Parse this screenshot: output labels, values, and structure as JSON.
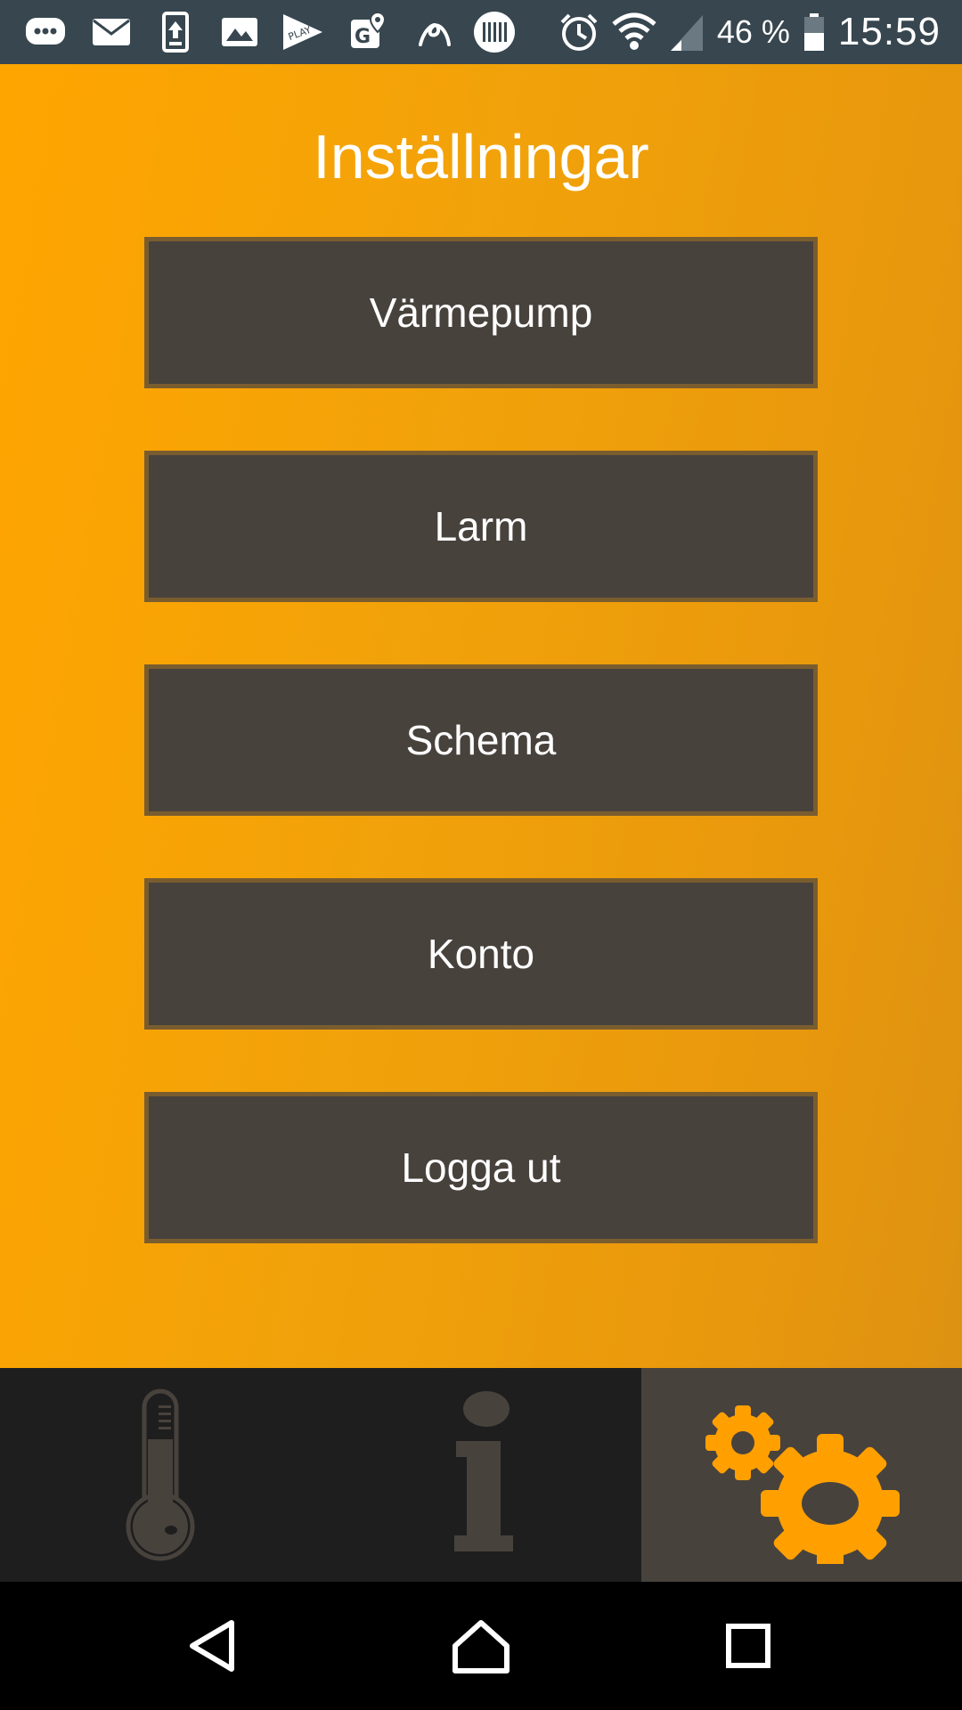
{
  "status_bar": {
    "battery_percent": "46 %",
    "time": "15:59",
    "notification_icons": [
      "chat-icon",
      "mail-icon",
      "upload-icon",
      "image-icon",
      "play-store-icon",
      "maps-icon",
      "app-icon",
      "barcode-icon"
    ],
    "system_icons": [
      "alarm-icon",
      "wifi-icon",
      "signal-icon",
      "battery-icon"
    ]
  },
  "screen": {
    "title": "Inställningar"
  },
  "menu": {
    "items": [
      {
        "label": "Värmepump"
      },
      {
        "label": "Larm"
      },
      {
        "label": "Schema"
      },
      {
        "label": "Konto"
      },
      {
        "label": "Logga ut"
      }
    ]
  },
  "tabbar": {
    "tabs": [
      {
        "icon": "thermometer-icon",
        "active": false
      },
      {
        "icon": "info-icon",
        "active": false
      },
      {
        "icon": "gears-icon",
        "active": true
      }
    ]
  },
  "navbar": {
    "buttons": [
      "back-icon",
      "home-icon",
      "recents-icon"
    ]
  },
  "colors": {
    "accent": "#ffa500",
    "button_bg": "#48423d",
    "button_border": "#7a5d2f",
    "tabbar_bg": "#1e1e1e",
    "statusbar_bg": "#37464f"
  }
}
